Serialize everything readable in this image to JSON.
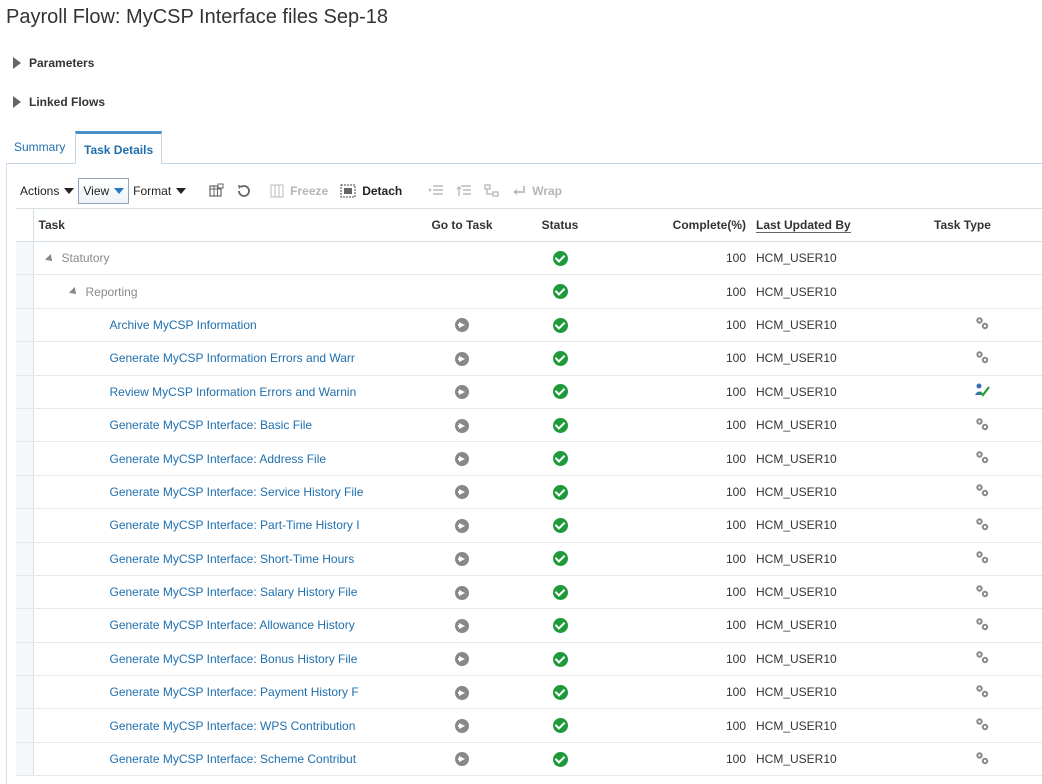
{
  "page": {
    "title": "Payroll Flow: MyCSP Interface files Sep-18"
  },
  "sections": {
    "parameters": "Parameters",
    "linked_flows": "Linked Flows"
  },
  "tabs": [
    {
      "label": "Summary",
      "active": false
    },
    {
      "label": "Task Details",
      "active": true
    }
  ],
  "toolbar": {
    "actions": "Actions",
    "view": "View",
    "format": "Format",
    "freeze": "Freeze",
    "detach": "Detach",
    "wrap": "Wrap"
  },
  "columns": {
    "task": "Task",
    "goto": "Go to Task",
    "status": "Status",
    "complete": "Complete(%)",
    "last_updated_by": "Last Updated By",
    "task_type": "Task Type"
  },
  "rows": [
    {
      "task": "Statutory",
      "level": 0,
      "complete": "100",
      "updated_by": "HCM_USER10",
      "type": ""
    },
    {
      "task": "Reporting",
      "level": 1,
      "complete": "100",
      "updated_by": "HCM_USER10",
      "type": ""
    },
    {
      "task": "Archive MyCSP Information",
      "level": 2,
      "complete": "100",
      "updated_by": "HCM_USER10",
      "type": "gear"
    },
    {
      "task": "Generate MyCSP Information Errors and Warr",
      "level": 2,
      "complete": "100",
      "updated_by": "HCM_USER10",
      "type": "gear"
    },
    {
      "task": "Review MyCSP Information Errors and Warnin",
      "level": 2,
      "complete": "100",
      "updated_by": "HCM_USER10",
      "type": "review"
    },
    {
      "task": "Generate MyCSP Interface: Basic File",
      "level": 2,
      "complete": "100",
      "updated_by": "HCM_USER10",
      "type": "gear"
    },
    {
      "task": "Generate MyCSP Interface: Address File",
      "level": 2,
      "complete": "100",
      "updated_by": "HCM_USER10",
      "type": "gear"
    },
    {
      "task": "Generate MyCSP Interface: Service History File",
      "level": 2,
      "complete": "100",
      "updated_by": "HCM_USER10",
      "type": "gear"
    },
    {
      "task": "Generate MyCSP Interface: Part-Time History I",
      "level": 2,
      "complete": "100",
      "updated_by": "HCM_USER10",
      "type": "gear"
    },
    {
      "task": "Generate MyCSP Interface: Short-Time Hours",
      "level": 2,
      "complete": "100",
      "updated_by": "HCM_USER10",
      "type": "gear"
    },
    {
      "task": "Generate MyCSP Interface: Salary History File",
      "level": 2,
      "complete": "100",
      "updated_by": "HCM_USER10",
      "type": "gear"
    },
    {
      "task": "Generate MyCSP Interface: Allowance History",
      "level": 2,
      "complete": "100",
      "updated_by": "HCM_USER10",
      "type": "gear"
    },
    {
      "task": "Generate MyCSP Interface: Bonus History File",
      "level": 2,
      "complete": "100",
      "updated_by": "HCM_USER10",
      "type": "gear"
    },
    {
      "task": "Generate MyCSP Interface: Payment History F",
      "level": 2,
      "complete": "100",
      "updated_by": "HCM_USER10",
      "type": "gear"
    },
    {
      "task": "Generate MyCSP Interface: WPS Contribution",
      "level": 2,
      "complete": "100",
      "updated_by": "HCM_USER10",
      "type": "gear"
    },
    {
      "task": "Generate MyCSP Interface: Scheme Contribut",
      "level": 2,
      "complete": "100",
      "updated_by": "HCM_USER10",
      "type": "gear"
    }
  ],
  "colors": {
    "link": "#1f6fae",
    "status_ok": "#1e9a3a",
    "tab_active": "#4a90c8"
  }
}
